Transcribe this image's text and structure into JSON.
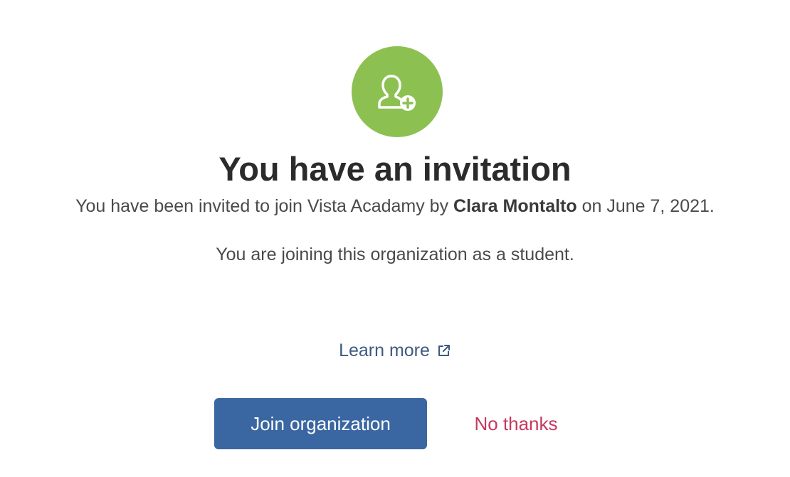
{
  "invitation": {
    "icon": "user-add-icon",
    "accent_color": "#8cc152",
    "title": "You have an invitation",
    "invite_prefix": "You have been invited to join Vista Acadamy by ",
    "inviter_name": "Clara Montalto",
    "invite_suffix": " on June 7, 2021.",
    "role_text": "You are joining this organization as a student."
  },
  "links": {
    "learn_more_label": "Learn more",
    "learn_more_icon": "external-link-icon"
  },
  "actions": {
    "join_label": "Join organization",
    "join_color": "#3a67a2",
    "decline_label": "No thanks",
    "decline_color": "#c8375e"
  }
}
